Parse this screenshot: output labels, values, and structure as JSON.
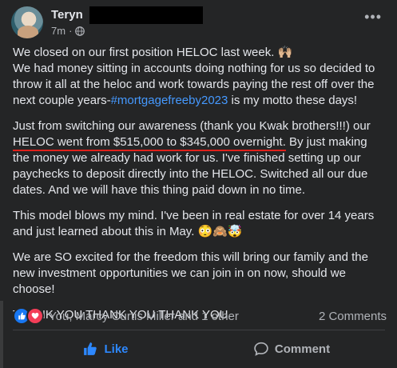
{
  "post": {
    "author": "Teryn",
    "time": "7m",
    "separator": "·",
    "paragraphs": {
      "p1_a": "We closed on our first position HELOC last week. 🙌🏼",
      "p1_b": "We had money sitting in accounts doing nothing for us so decided to throw it all at the heloc and work towards paying the rest off over the next couple years-",
      "p1_hashtag": "#mortgagefreeby2023",
      "p1_c": " is my motto these days!",
      "p2_a": "Just from switching our awareness (thank you Kwak brothers!!!) our ",
      "p2_underlined": "HELOC went from $515,000 to $345,000 overnight.",
      "p2_b": " By just making the money we already had work for us. I've finished setting up our paychecks to deposit directly into the HELOC. Switched all our due dates. And we will have this thing paid down in no time.",
      "p3": "This model blows my mind. I've been in real estate for over 14 years and just learned about this in May. 😳🙈🤯",
      "p4": "We are SO excited for the freedom this will bring our family and the new investment opportunities we can join in on now, should we choose!",
      "p5": "THANK YOU THANK YOU THANK YOU"
    }
  },
  "reactions": {
    "summary": "You, Marcy Curtis Miller and 1 other",
    "comments": "2 Comments"
  },
  "actions": {
    "like": "Like",
    "comment": "Comment"
  },
  "icons": {
    "privacy": "globe-icon",
    "more": "more-options-icon",
    "like": "thumbs-up-icon",
    "love": "heart-icon",
    "comment": "comment-bubble-icon"
  }
}
